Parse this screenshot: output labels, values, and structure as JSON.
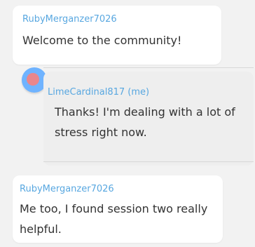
{
  "chat": {
    "messages": [
      {
        "username": "RubyMerganzer7026",
        "text": "Welcome to the community!"
      },
      {
        "username": "LimeCardinal817 (me)",
        "text": "Thanks! I'm dealing with a lot of stress right now."
      },
      {
        "username": "RubyMerganzer7026",
        "text": "Me too, I found session two really helpful."
      }
    ]
  },
  "colors": {
    "username": "#58a7e0",
    "message_text": "#333333",
    "my_bubble_bg": "#eeeeee",
    "other_bubble_bg": "#ffffff",
    "avatar_outer": "#6fb3ff",
    "avatar_inner": "#ff7e78"
  },
  "icons": {
    "avatar": "avatar-icon"
  }
}
